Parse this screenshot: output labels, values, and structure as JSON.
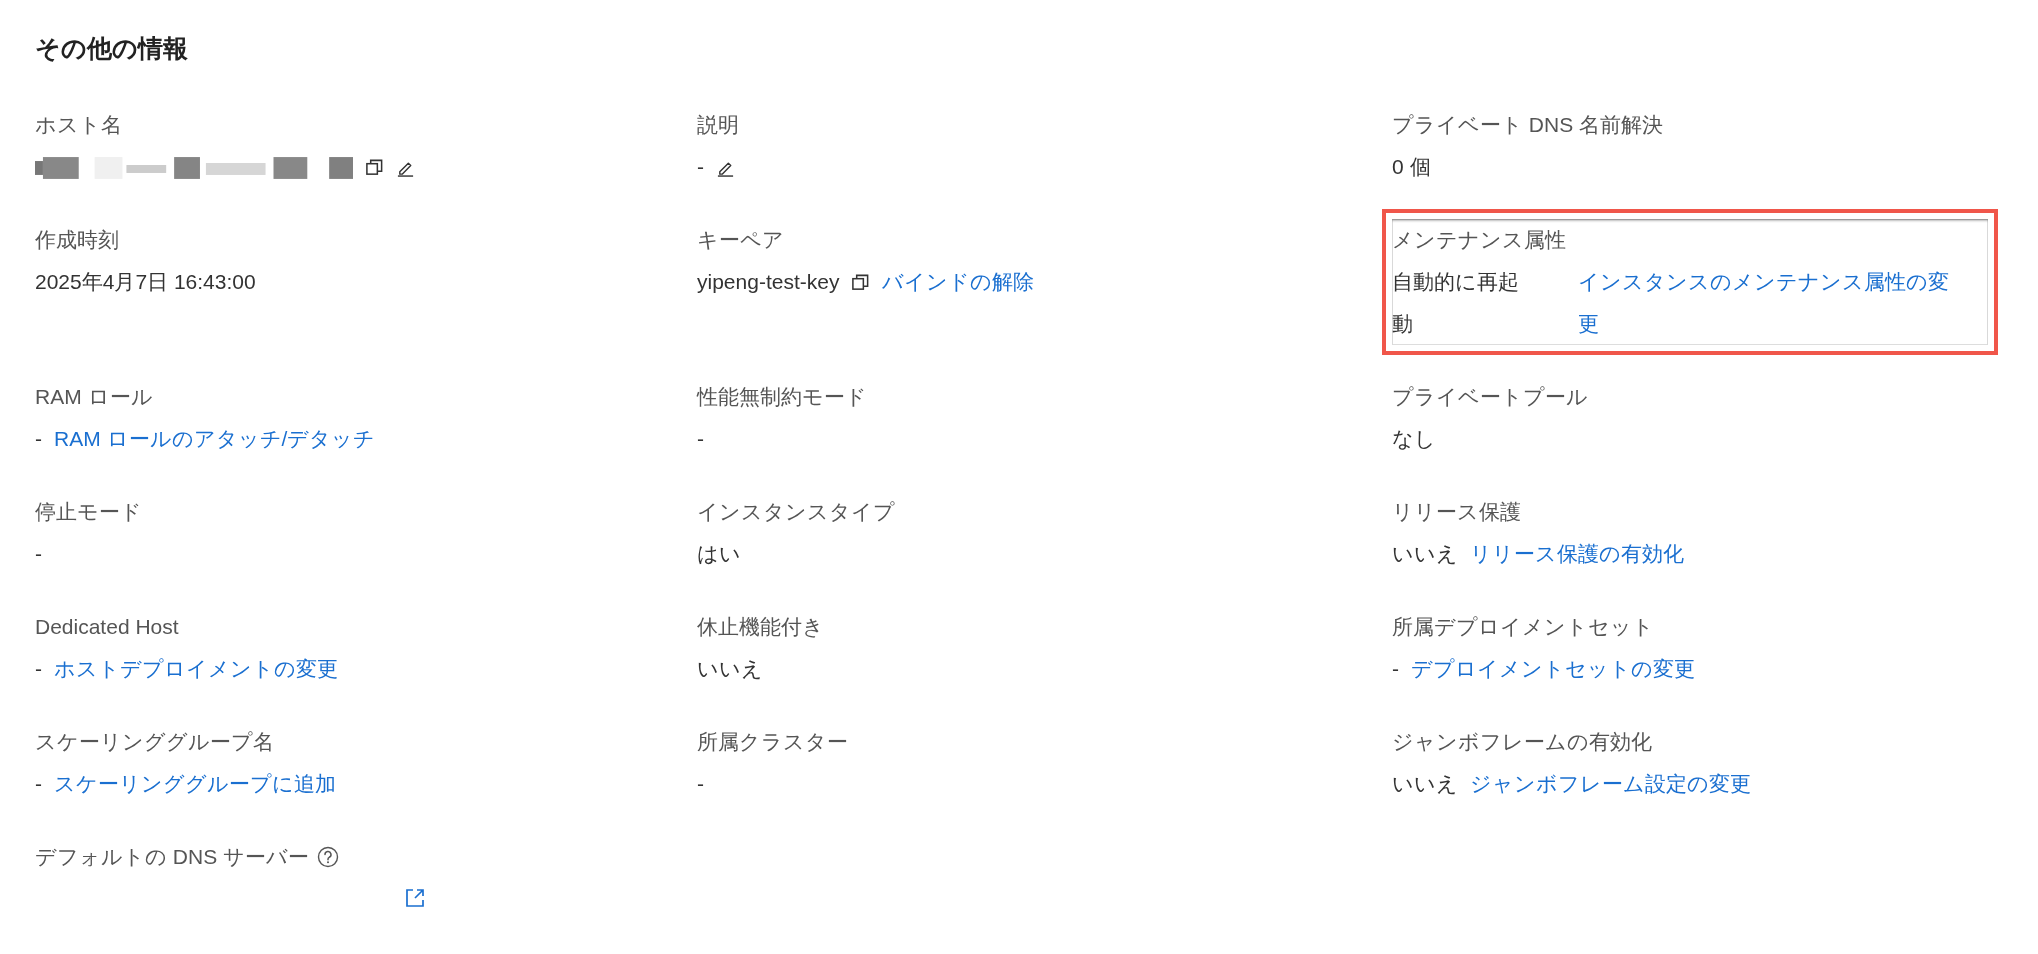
{
  "title": "その他の情報",
  "fields": [
    {
      "label": "ホスト名",
      "redacted": true,
      "copyable": true,
      "editable": true
    },
    {
      "label": "説明",
      "value": "-",
      "editable": true
    },
    {
      "label": "プライベート DNS 名前解決",
      "value": "0 個"
    },
    {
      "label": "作成時刻",
      "value": "2025年4月7日 16:43:00"
    },
    {
      "label": "キーペア",
      "value": "yipeng-test-key",
      "copyable": true,
      "link": "バインドの解除"
    },
    {
      "label": "メンテナンス属性",
      "value": "自動的に再起動",
      "link": "インスタンスのメンテナンス属性の変更",
      "highlighted": true
    },
    {
      "label": "RAM ロール",
      "value": "-",
      "link": "RAM ロールのアタッチ/デタッチ"
    },
    {
      "label": "性能無制約モード",
      "value": "-"
    },
    {
      "label": "プライベートプール",
      "value": "なし"
    },
    {
      "label": "停止モード",
      "value": "-"
    },
    {
      "label": "インスタンスタイプ",
      "value": "はい"
    },
    {
      "label": "リリース保護",
      "value": "いいえ",
      "link": "リリース保護の有効化"
    },
    {
      "label": "Dedicated Host",
      "value": "-",
      "link": "ホストデプロイメントの変更"
    },
    {
      "label": "休止機能付き",
      "value": "いいえ"
    },
    {
      "label": "所属デプロイメントセット",
      "value": "-",
      "link": "デプロイメントセットの変更"
    },
    {
      "label": "スケーリンググループ名",
      "value": "-",
      "link": "スケーリンググループに追加"
    },
    {
      "label": "所属クラスター",
      "value": "-"
    },
    {
      "label": "ジャンボフレームの有効化",
      "value": "いいえ",
      "link": "ジャンボフレーム設定の変更"
    },
    {
      "label": "デフォルトの DNS サーバー",
      "help": true,
      "external_link": true
    }
  ]
}
